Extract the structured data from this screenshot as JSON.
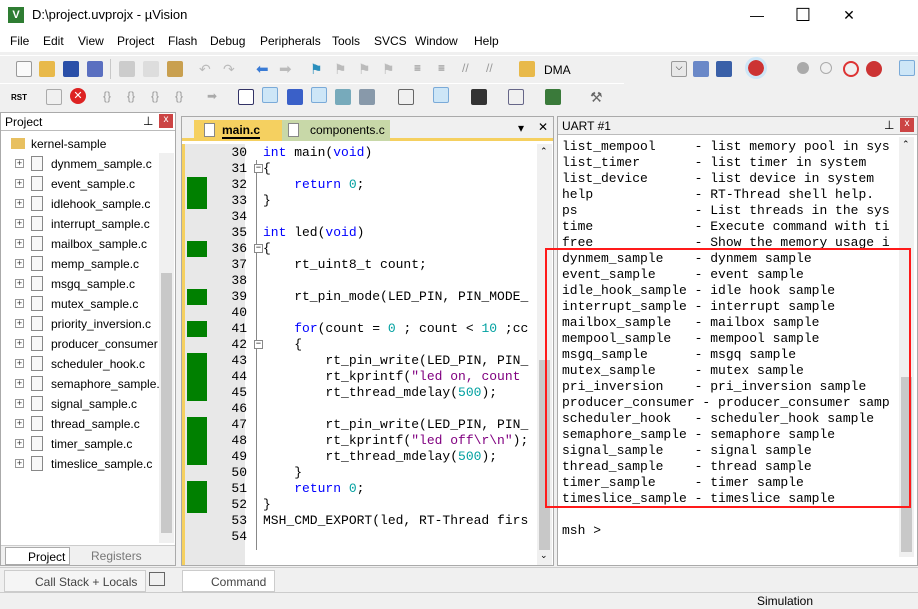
{
  "window": {
    "title": "D:\\project.uvprojx - µVision",
    "minimize": "—",
    "maximize": "☐",
    "close": "✕"
  },
  "menu": [
    "File",
    "Edit",
    "View",
    "Project",
    "Flash",
    "Debug",
    "Peripherals",
    "Tools",
    "SVCS",
    "Window",
    "Help"
  ],
  "toolbar": {
    "target": "DMA",
    "rst": "RST"
  },
  "project": {
    "title": "Project",
    "root": "kernel-sample",
    "files": [
      "dynmem_sample.c",
      "event_sample.c",
      "idlehook_sample.c",
      "interrupt_sample.c",
      "mailbox_sample.c",
      "memp_sample.c",
      "msgq_sample.c",
      "mutex_sample.c",
      "priority_inversion.c",
      "producer_consumer",
      "scheduler_hook.c",
      "semaphore_sample.",
      "signal_sample.c",
      "thread_sample.c",
      "timer_sample.c",
      "timeslice_sample.c"
    ],
    "tabs": [
      "Project",
      "Registers"
    ]
  },
  "editor": {
    "tabs": [
      "main.c",
      "components.c"
    ],
    "lines": [
      {
        "n": "30",
        "cov": false,
        "fold": "",
        "seg": [
          [
            "int",
            "kw"
          ],
          " main(",
          [
            "void",
            "kw"
          ],
          ")"
        ]
      },
      {
        "n": "31",
        "cov": false,
        "fold": "−",
        "seg": [
          "{"
        ]
      },
      {
        "n": "32",
        "cov": true,
        "fold": "",
        "seg": [
          "    ",
          [
            "return",
            "kw"
          ],
          " ",
          [
            "0",
            "num"
          ],
          ";"
        ]
      },
      {
        "n": "33",
        "cov": true,
        "fold": "",
        "seg": [
          "}"
        ]
      },
      {
        "n": "34",
        "cov": false,
        "fold": "",
        "seg": [
          ""
        ]
      },
      {
        "n": "35",
        "cov": false,
        "fold": "",
        "seg": [
          [
            "int",
            "kw"
          ],
          " led(",
          [
            "void",
            "kw"
          ],
          ")"
        ]
      },
      {
        "n": "36",
        "cov": true,
        "fold": "−",
        "seg": [
          "{"
        ]
      },
      {
        "n": "37",
        "cov": false,
        "fold": "",
        "seg": [
          "    rt_uint8_t count;"
        ]
      },
      {
        "n": "38",
        "cov": false,
        "fold": "",
        "seg": [
          ""
        ]
      },
      {
        "n": "39",
        "cov": true,
        "fold": "",
        "seg": [
          "    rt_pin_mode(LED_PIN, PIN_MODE_"
        ]
      },
      {
        "n": "40",
        "cov": false,
        "fold": "",
        "seg": [
          ""
        ]
      },
      {
        "n": "41",
        "cov": true,
        "fold": "",
        "seg": [
          "    ",
          [
            "for",
            "kw"
          ],
          "(count = ",
          [
            "0",
            "num"
          ],
          " ; count < ",
          [
            "10",
            "num"
          ],
          " ;cc"
        ]
      },
      {
        "n": "42",
        "cov": false,
        "fold": "−",
        "seg": [
          "    {"
        ]
      },
      {
        "n": "43",
        "cov": true,
        "fold": "",
        "seg": [
          "        rt_pin_write(LED_PIN, PIN_"
        ]
      },
      {
        "n": "44",
        "cov": true,
        "fold": "",
        "seg": [
          "        rt_kprintf(",
          [
            "\"led on, count ",
            "str"
          ]
        ]
      },
      {
        "n": "45",
        "cov": true,
        "fold": "",
        "seg": [
          "        rt_thread_mdelay(",
          [
            "500",
            "num"
          ],
          ");"
        ]
      },
      {
        "n": "46",
        "cov": false,
        "fold": "",
        "seg": [
          ""
        ]
      },
      {
        "n": "47",
        "cov": true,
        "fold": "",
        "seg": [
          "        rt_pin_write(LED_PIN, PIN_"
        ]
      },
      {
        "n": "48",
        "cov": true,
        "fold": "",
        "seg": [
          "        rt_kprintf(",
          [
            "\"led off\\r\\n\"",
            "str"
          ],
          ");"
        ]
      },
      {
        "n": "49",
        "cov": true,
        "fold": "",
        "seg": [
          "        rt_thread_mdelay(",
          [
            "500",
            "num"
          ],
          ");"
        ]
      },
      {
        "n": "50",
        "cov": false,
        "fold": "",
        "seg": [
          "    }"
        ]
      },
      {
        "n": "51",
        "cov": true,
        "fold": "",
        "seg": [
          "    ",
          [
            "return",
            "kw"
          ],
          " ",
          [
            "0",
            "num"
          ],
          ";"
        ]
      },
      {
        "n": "52",
        "cov": true,
        "fold": "",
        "seg": [
          "}"
        ]
      },
      {
        "n": "53",
        "cov": false,
        "fold": "",
        "seg": [
          "MSH_CMD_EXPORT(led, RT-Thread firs"
        ]
      },
      {
        "n": "54",
        "cov": false,
        "fold": "",
        "seg": [
          ""
        ]
      }
    ]
  },
  "uart": {
    "title": "UART #1",
    "lines": [
      "list_mempool     - list memory pool in sys",
      "list_timer       - list timer in system",
      "list_device      - list device in system",
      "help             - RT-Thread shell help.",
      "ps               - List threads in the sys",
      "time             - Execute command with ti",
      "free             - Show the memory usage i",
      "dynmem_sample    - dynmem sample",
      "event_sample     - event sample",
      "idle_hook_sample - idle hook sample",
      "interrupt_sample - interrupt sample",
      "mailbox_sample   - mailbox sample",
      "mempool_sample   - mempool sample",
      "msgq_sample      - msgq sample",
      "mutex_sample     - mutex sample",
      "pri_inversion    - pri_inversion sample",
      "producer_consumer - producer_consumer samp",
      "scheduler_hook   - scheduler_hook sample",
      "semaphore_sample - semaphore sample",
      "signal_sample    - signal sample",
      "thread_sample    - thread sample",
      "timer_sample     - timer sample",
      "timeslice_sample - timeslice sample",
      "",
      "msh >"
    ],
    "highlight_color": "#ff1a1a"
  },
  "bottom": {
    "tabs": [
      "Call Stack + Locals",
      "Command"
    ]
  },
  "status": {
    "mode": "Simulation"
  }
}
